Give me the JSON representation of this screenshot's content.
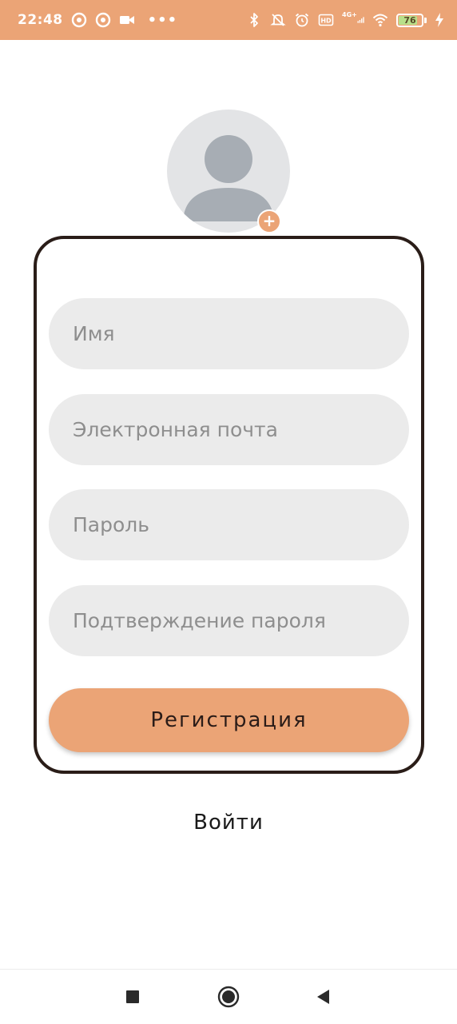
{
  "status_bar": {
    "time": "22:48",
    "battery": "76",
    "network": "4G+",
    "dots": "•••",
    "icons": [
      "sync-icon",
      "sync-icon",
      "video-icon",
      "bluetooth-icon",
      "mute-bell-icon",
      "alarm-icon",
      "volte-icon",
      "signal-icon",
      "wifi-icon",
      "battery-icon",
      "charging-icon"
    ]
  },
  "avatar": {
    "add_symbol": "+"
  },
  "form": {
    "name_placeholder": "Имя",
    "email_placeholder": "Электронная почта",
    "password_placeholder": "Пароль",
    "confirm_placeholder": "Подтверждение пароля",
    "register_label": "Регистрация"
  },
  "login_link": "Войти",
  "colors": {
    "accent": "#eba476",
    "card_border": "#2a1d18",
    "field_bg": "#ebebeb",
    "avatar_bg": "#e3e4e6"
  }
}
